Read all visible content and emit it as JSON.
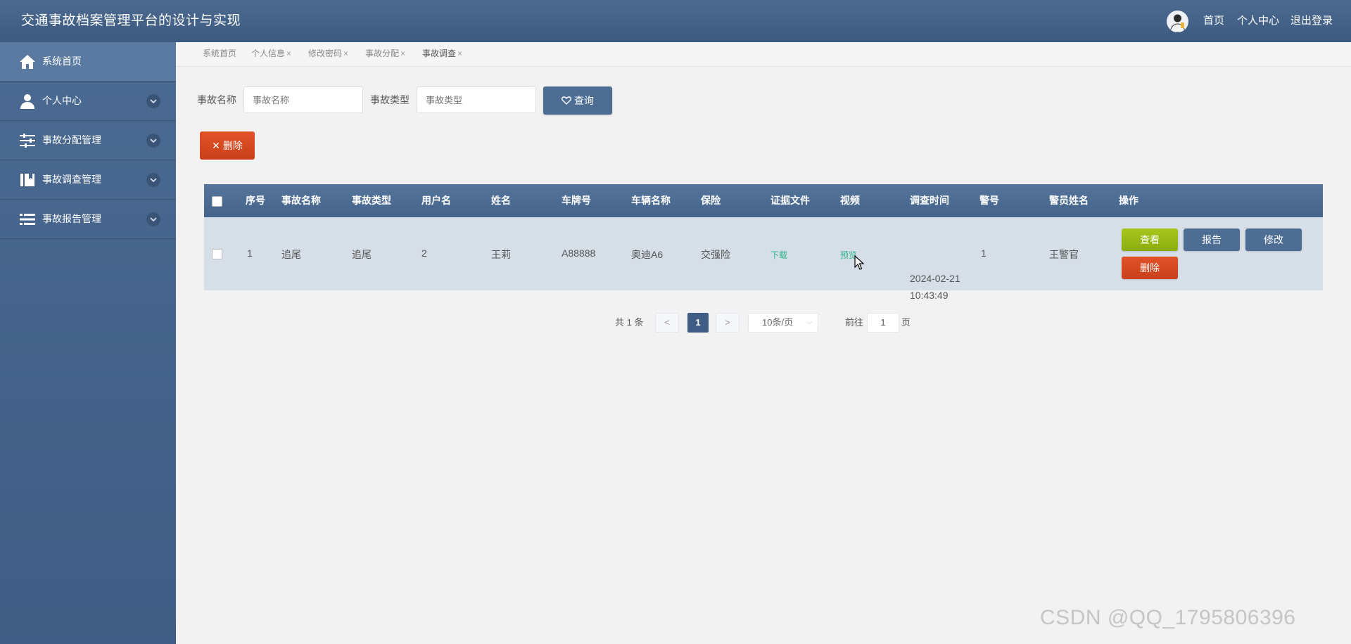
{
  "header": {
    "app_title": "交通事故档案管理平台的设计与实现",
    "links": [
      "首页",
      "个人中心",
      "退出登录"
    ]
  },
  "sidebar": {
    "items": [
      {
        "label": "系统首页",
        "icon": "home-icon",
        "expandable": false
      },
      {
        "label": "个人中心",
        "icon": "user-icon",
        "expandable": true
      },
      {
        "label": "事故分配管理",
        "icon": "sliders-icon",
        "expandable": true
      },
      {
        "label": "事故调查管理",
        "icon": "book-icon",
        "expandable": true
      },
      {
        "label": "事故报告管理",
        "icon": "list-icon",
        "expandable": true
      }
    ]
  },
  "tabs": [
    {
      "label": "系统首页",
      "closable": false
    },
    {
      "label": "个人信息",
      "closable": true
    },
    {
      "label": "修改密码",
      "closable": true
    },
    {
      "label": "事故分配",
      "closable": true
    },
    {
      "label": "事故调查",
      "closable": true,
      "active": true
    }
  ],
  "search": {
    "name_label": "事故名称",
    "name_placeholder": "事故名称",
    "type_label": "事故类型",
    "type_placeholder": "事故类型",
    "query_button": "查询"
  },
  "toolbar": {
    "delete_label": "删除"
  },
  "table": {
    "columns": [
      "序号",
      "事故名称",
      "事故类型",
      "用户名",
      "姓名",
      "车牌号",
      "车辆名称",
      "保险",
      "证据文件",
      "视频",
      "调查时间",
      "警号",
      "警员姓名",
      "操作"
    ],
    "rows": [
      {
        "index": "1",
        "accident_name": "追尾",
        "accident_type": "追尾",
        "username": "2",
        "name": "王莉",
        "plate": "A88888",
        "vehicle": "奥迪A6",
        "insurance": "交强险",
        "evidence": "下载",
        "video": "预览",
        "time_date": "2024-02-21",
        "time_clock": "10:43:49",
        "badge_no": "1",
        "officer": "王警官",
        "actions": {
          "view": "查看",
          "report": "报告",
          "edit": "修改",
          "delete": "删除"
        }
      }
    ]
  },
  "pagination": {
    "total_text": "共 1 条",
    "prev": "<",
    "current": "1",
    "next": ">",
    "page_size": "10条/页",
    "goto_label": "前往",
    "goto_value": "1",
    "page_suffix": "页"
  },
  "watermark": "CSDN @QQ_1795806396",
  "colors": {
    "primary": "#4e6d93",
    "sidebar": "#4b6a91",
    "danger": "#d9481f",
    "success": "#9bbb12",
    "link_green": "#2cb48a"
  }
}
